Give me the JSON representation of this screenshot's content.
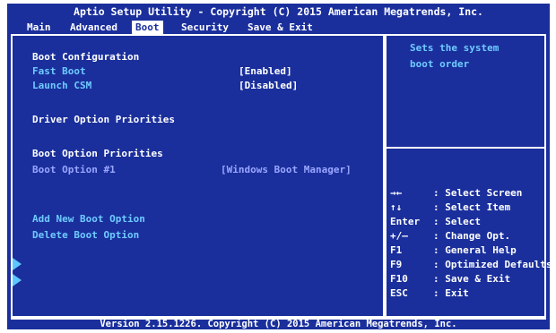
{
  "title": "Aptio Setup Utility - Copyright (C) 2015 American Megatrends, Inc.",
  "tabs": [
    "Main",
    "Advanced",
    "Boot",
    "Security",
    "Save & Exit"
  ],
  "active_tab": "Boot",
  "left": {
    "boot_configuration": "Boot Configuration",
    "fast_boot_label": "Fast Boot",
    "fast_boot_value": "[Enabled]",
    "launch_csm_label": "Launch CSM",
    "launch_csm_value": "[Disabled]",
    "driver_option_priorities": "Driver Option Priorities",
    "boot_option_priorities": "Boot Option Priorities",
    "boot_option_1_label": "Boot Option #1",
    "boot_option_1_value": "[Windows Boot Manager]",
    "add_new_boot_option": "Add New Boot Option",
    "delete_boot_option": "Delete Boot Option"
  },
  "help": {
    "line1": "Sets the system",
    "line2": "boot order"
  },
  "legend": [
    {
      "key": "→←",
      "desc": ": Select Screen"
    },
    {
      "key": "↑↓",
      "desc": ": Select Item"
    },
    {
      "key": "Enter",
      "desc": ": Select"
    },
    {
      "key": "+/—",
      "desc": ": Change Opt."
    },
    {
      "key": "F1",
      "desc": ": General Help"
    },
    {
      "key": "F9",
      "desc": ": Optimized Defaults"
    },
    {
      "key": "F10",
      "desc": ": Save & Exit"
    },
    {
      "key": "ESC",
      "desc": ": Exit"
    }
  ],
  "footer": "Version 2.15.1226. Copyright (C) 2015 American Megatrends, Inc.",
  "colors": {
    "background": "#1a2f9c",
    "label": "#6fcbff",
    "selected": "#9aa6ff",
    "text": "#ffffff"
  }
}
